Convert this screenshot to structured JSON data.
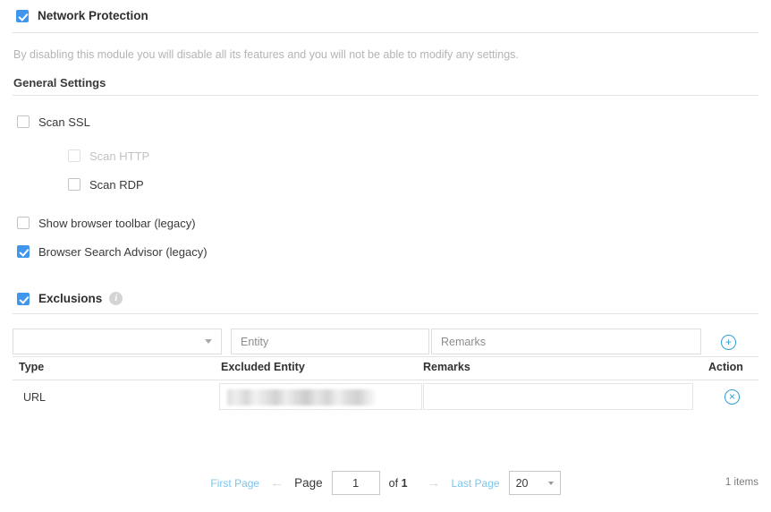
{
  "module": {
    "title": "Network Protection",
    "enabled": true,
    "note": "By disabling this module you will disable all its features and you will not be able to modify any settings."
  },
  "general": {
    "heading": "General Settings",
    "options": [
      {
        "label": "Scan SSL",
        "checked": false,
        "disabled": false,
        "indent": 0
      },
      {
        "label": "Scan HTTP",
        "checked": false,
        "disabled": true,
        "indent": 1
      },
      {
        "label": "Scan RDP",
        "checked": false,
        "disabled": false,
        "indent": 1
      },
      {
        "label": "Show browser toolbar (legacy)",
        "checked": false,
        "disabled": false,
        "indent": 0
      },
      {
        "label": "Browser Search Advisor (legacy)",
        "checked": true,
        "disabled": false,
        "indent": 0
      }
    ]
  },
  "exclusions": {
    "title": "Exclusions",
    "enabled": true,
    "info_icon": "info-icon",
    "info_glyph": "i",
    "form": {
      "type_value": "",
      "type_placeholder": "",
      "entity_placeholder": "Entity",
      "entity_value": "",
      "remarks_placeholder": "Remarks",
      "remarks_value": "",
      "add_icon": "plus-icon",
      "add_glyph": "+"
    },
    "columns": {
      "type": "Type",
      "entity": "Excluded Entity",
      "remarks": "Remarks",
      "action": "Action"
    },
    "rows": [
      {
        "type": "URL",
        "entity": "",
        "entity_redacted": true,
        "remarks": "",
        "delete_icon": "close-icon",
        "delete_glyph": "×"
      }
    ]
  },
  "pagination": {
    "first_page": "First Page",
    "prev_arrow": "←",
    "page_label": "Page",
    "page_value": "1",
    "of_prefix": "of",
    "total_pages": "1",
    "next_arrow": "→",
    "last_page": "Last Page",
    "page_size": "20",
    "items_count": "1 items"
  },
  "colors": {
    "accent_blue": "#3f96ea",
    "icon_blue": "#2e9fd4",
    "link_blue": "#7ec5ea",
    "muted_gray": "#b4b4b4"
  }
}
